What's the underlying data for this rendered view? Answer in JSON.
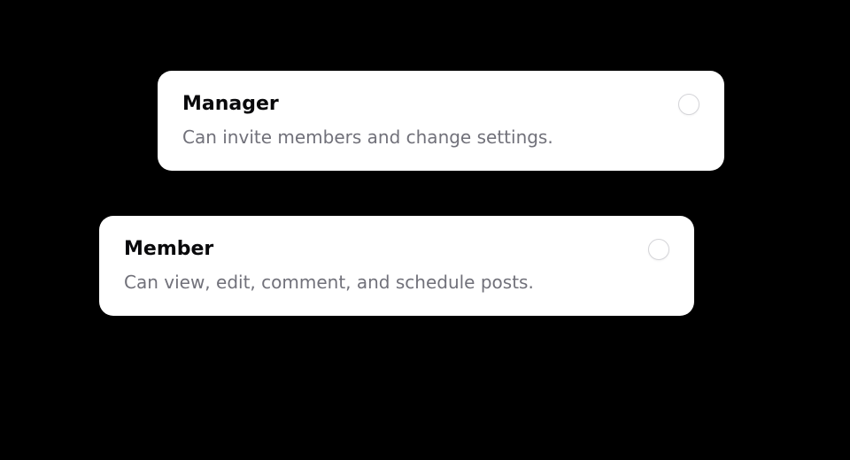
{
  "options": [
    {
      "title": "Manager",
      "description": "Can invite members and change settings."
    },
    {
      "title": "Member",
      "description": "Can view, edit, comment, and schedule posts."
    }
  ]
}
